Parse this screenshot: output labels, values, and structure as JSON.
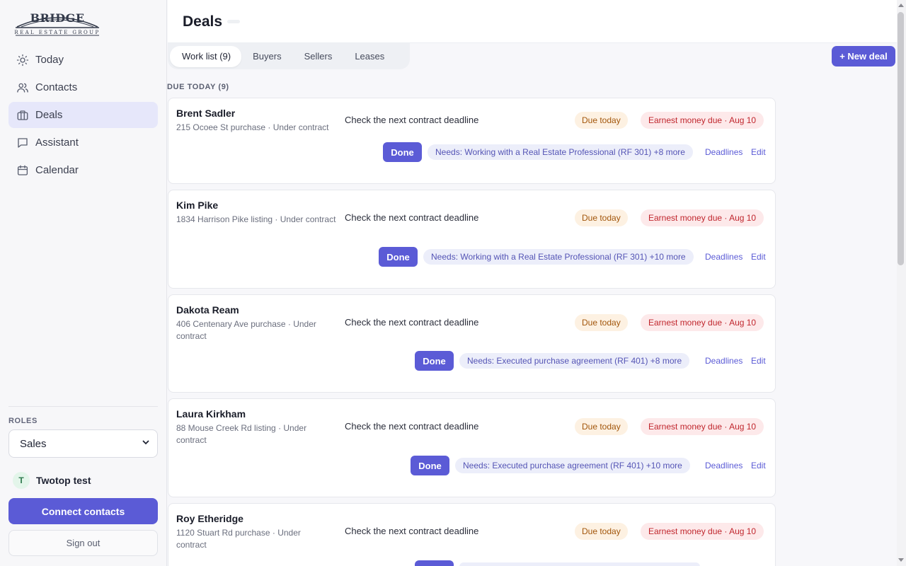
{
  "brand": {
    "name": "BRIDGE",
    "tagline": "REAL ESTATE GROUP"
  },
  "sidebar": {
    "nav": [
      {
        "label": "Today",
        "icon": "sun-icon"
      },
      {
        "label": "Contacts",
        "icon": "users-icon"
      },
      {
        "label": "Deals",
        "icon": "briefcase-icon",
        "active": true
      },
      {
        "label": "Assistant",
        "icon": "chat-bubble-icon"
      },
      {
        "label": "Calendar",
        "icon": "calendar-icon"
      }
    ],
    "roles_label": "ROLES",
    "roles_selected": "Sales",
    "user_initial": "T",
    "user_name": "Twotop test",
    "connect_label": "Connect contacts",
    "signout_label": "Sign out"
  },
  "header": {
    "title": "Deals"
  },
  "tabs": [
    "Work list (9)",
    "Buyers",
    "Sellers",
    "Leases"
  ],
  "new_deal_label": "+ New deal",
  "section_label": "DUE TODAY (9)",
  "card_labels": {
    "done": "Done",
    "deadlines": "Deadlines",
    "edit": "Edit"
  },
  "deals": [
    {
      "name": "Brent Sadler",
      "address": "215 Ocoee St purchase · Under contract",
      "task": "Check the next contract deadline",
      "due": "Due today",
      "earnest": "Earnest money due · Aug 10",
      "needs": "Needs: Working with a Real Estate Professional (RF 301) +8 more"
    },
    {
      "name": "Kim Pike",
      "address": "1834 Harrison Pike listing · Under contract",
      "task": "Check the next contract deadline",
      "due": "Due today",
      "earnest": "Earnest money due · Aug 10",
      "needs": "Needs: Working with a Real Estate Professional (RF 301) +10 more"
    },
    {
      "name": "Dakota Ream",
      "address": "406 Centenary Ave purchase · Under contract",
      "task": "Check the next contract deadline",
      "due": "Due today",
      "earnest": "Earnest money due · Aug 10",
      "needs": "Needs: Executed purchase agreement (RF 401) +8 more"
    },
    {
      "name": "Laura Kirkham",
      "address": "88 Mouse Creek Rd listing · Under contract",
      "task": "Check the next contract deadline",
      "due": "Due today",
      "earnest": "Earnest money due · Aug 10",
      "needs": "Needs: Executed purchase agreement (RF 401) +10 more"
    },
    {
      "name": "Roy Etheridge",
      "address": "1120 Stuart Rd purchase · Under contract",
      "task": "Check the next contract deadline",
      "due": "Due today",
      "earnest": "Earnest money due · Aug 10",
      "needs": ""
    }
  ]
}
